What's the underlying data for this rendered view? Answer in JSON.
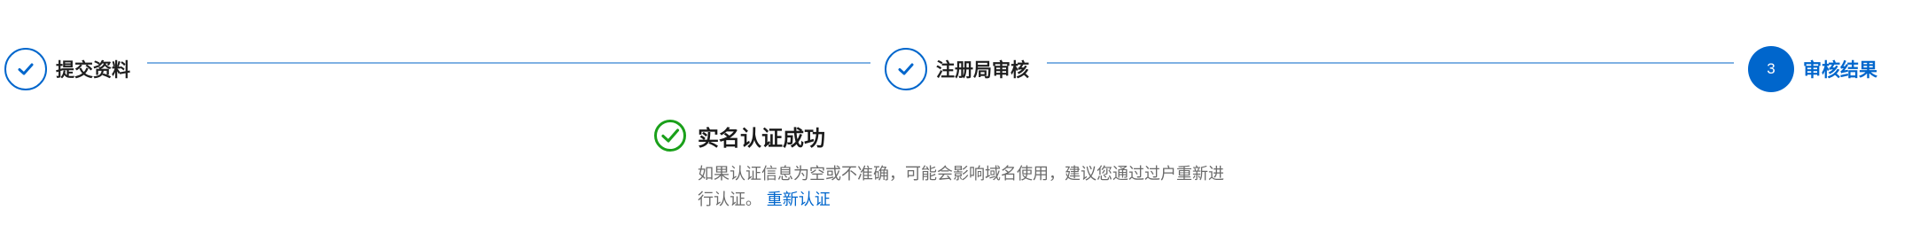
{
  "stepper": {
    "steps": [
      {
        "label": "提交资料",
        "state": "done"
      },
      {
        "label": "注册局审核",
        "state": "done"
      },
      {
        "label": "审核结果",
        "state": "active",
        "number": "3"
      }
    ],
    "colors": {
      "accent": "#0066cc",
      "connector": "#7fb1e3"
    }
  },
  "result": {
    "icon": "check-circle-icon",
    "icon_color": "#1aa01a",
    "title": "实名认证成功",
    "description": "如果认证信息为空或不准确，可能会影响域名使用，建议您通过过户重新进行认证。",
    "link_label": "重新认证"
  }
}
